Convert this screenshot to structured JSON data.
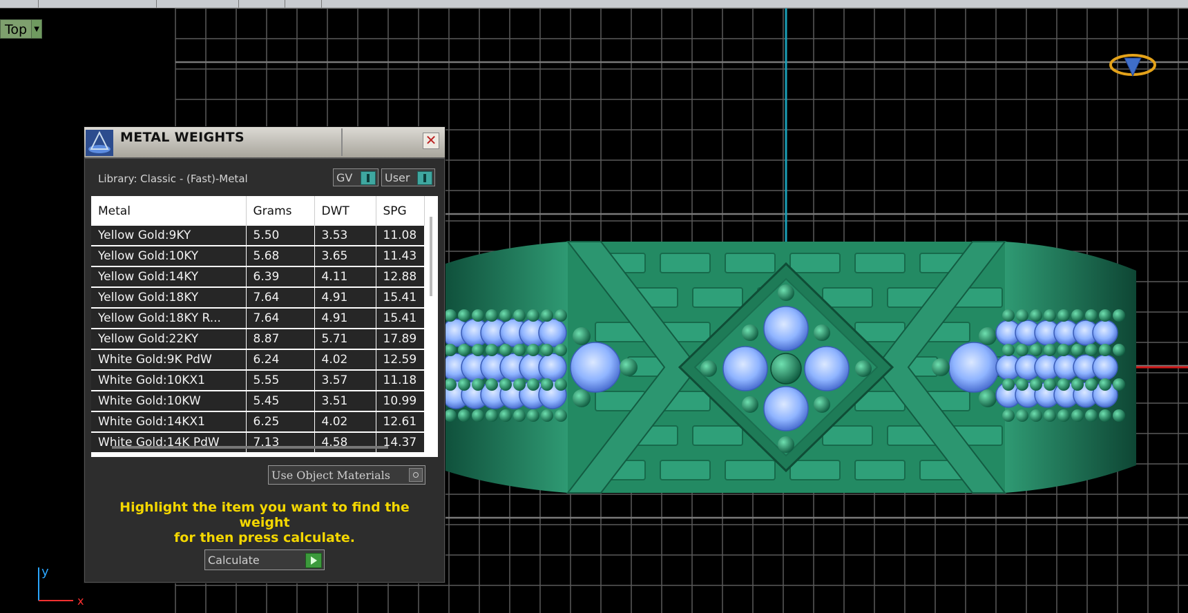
{
  "viewport": {
    "view_name": "Top"
  },
  "dialog": {
    "title": "METAL WEIGHTS",
    "close_symbol": "✕",
    "library_label": "Library: Classic - (Fast)-Metal",
    "toggle_gv": "GV",
    "toggle_user": "User",
    "columns": [
      "Metal",
      "Grams",
      "DWT",
      "SPG"
    ],
    "rows": [
      [
        "Yellow Gold:9KY",
        "5.50",
        "3.53",
        "11.08"
      ],
      [
        "Yellow Gold:10KY",
        "5.68",
        "3.65",
        "11.43"
      ],
      [
        "Yellow Gold:14KY",
        "6.39",
        "4.11",
        "12.88"
      ],
      [
        "Yellow Gold:18KY",
        "7.64",
        "4.91",
        "15.41"
      ],
      [
        "Yellow Gold:18KY R...",
        "7.64",
        "4.91",
        "15.41"
      ],
      [
        "Yellow Gold:22KY",
        "8.87",
        "5.71",
        "17.89"
      ],
      [
        "White Gold:9K PdW",
        "6.24",
        "4.02",
        "12.59"
      ],
      [
        "White Gold:10KX1",
        "5.55",
        "3.57",
        "11.18"
      ],
      [
        "White Gold:10KW",
        "5.45",
        "3.51",
        "10.99"
      ],
      [
        "White Gold:14KX1",
        "6.25",
        "4.02",
        "12.61"
      ],
      [
        "White Gold:14K PdW",
        "7.13",
        "4.58",
        "14.37"
      ]
    ],
    "use_object_materials": "Use Object Materials",
    "hint_line1": "Highlight the item you want to find the weight",
    "hint_line2": "for then press calculate.",
    "calculate_label": "Calculate"
  },
  "axes": {
    "y_label": "y",
    "x_label": "x"
  },
  "colors": {
    "ring_green": "#2a8f6a",
    "gem_blue": "#8fb4ff",
    "hint_yellow": "#f4d700",
    "grid": "#5a5a5a",
    "y_axis_line": "#1aa0b8"
  }
}
